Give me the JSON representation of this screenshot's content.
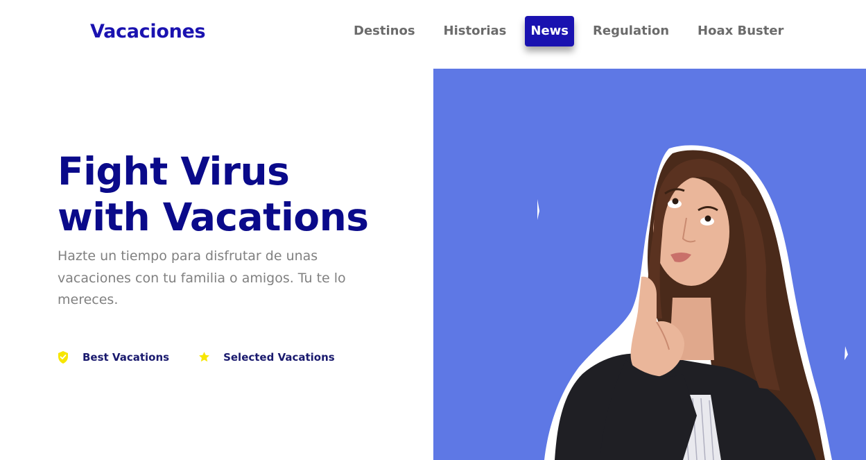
{
  "header": {
    "brand": "Vacaciones",
    "nav": [
      {
        "label": "Destinos",
        "active": false
      },
      {
        "label": "Historias",
        "active": false
      },
      {
        "label": "News",
        "active": true
      },
      {
        "label": "Regulation",
        "active": false
      },
      {
        "label": "Hoax Buster",
        "active": false
      }
    ]
  },
  "hero": {
    "title_line1": "Fight Virus",
    "title_line2": "with Vacations",
    "subtitle": "Hazte un tiempo para disfrutar de unas vacaciones con tu familia o amigos. Tu te lo mereces.",
    "features": [
      {
        "icon": "shield-icon",
        "label": "Best Vacations"
      },
      {
        "icon": "star-icon",
        "label": "Selected Vacations"
      }
    ]
  },
  "colors": {
    "brand": "#1a12b0",
    "heading": "#0a0a8a",
    "nav_text": "#6b6b6b",
    "image_bg": "#5e78e5",
    "feature_icon": "#f7e600"
  }
}
